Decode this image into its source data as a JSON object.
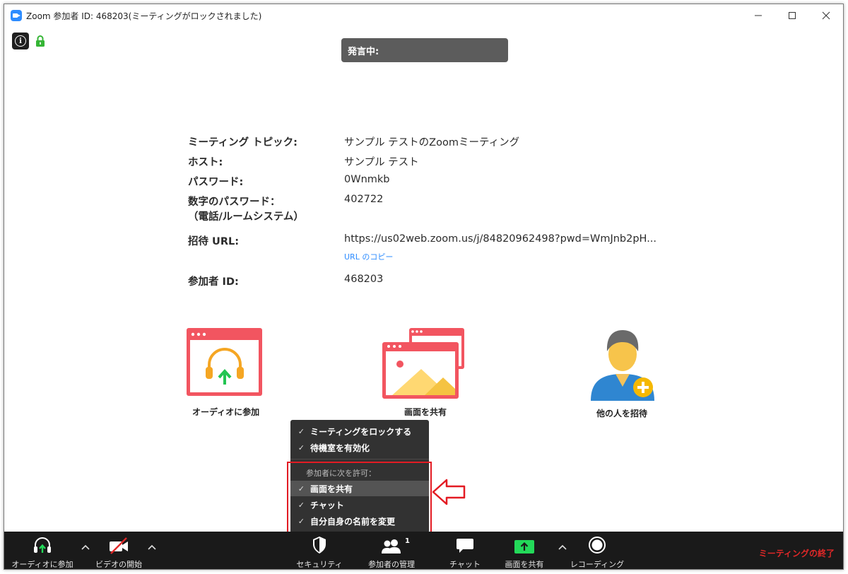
{
  "window": {
    "title": "Zoom 参加者 ID: 468203(ミーティングがロックされました)",
    "minimize": "—",
    "maximize": "☐",
    "close": "✕"
  },
  "speaking": "発言中:",
  "meeting_info": [
    {
      "label": "ミーティング トピック:",
      "value": "サンプル テストのZoomミーティング"
    },
    {
      "label": "ホスト:",
      "value": "サンプル テスト"
    },
    {
      "label": "パスワード:",
      "value": "0Wnmkb"
    },
    {
      "label": "数字のパスワード：",
      "label2": "（電話/ルームシステム）",
      "value": "402722"
    },
    {
      "label": "招待 URL:",
      "value": "https://us02web.zoom.us/j/84820962498?pwd=WmJnb2pH...",
      "link": "URL のコピー"
    },
    {
      "label": "参加者 ID:",
      "value": "468203"
    }
  ],
  "tiles": {
    "audio": "オーディオに参加",
    "share": "画面を共有",
    "invite": "他の人を招待"
  },
  "security_menu": {
    "items_top": [
      {
        "label": "ミーティングをロックする",
        "checked": true
      },
      {
        "label": "待機室を有効化",
        "checked": true
      }
    ],
    "section": "参加者に次を許可：",
    "items_allow": [
      {
        "label": "画面を共有",
        "checked": true,
        "highlighted": true
      },
      {
        "label": "チャット",
        "checked": true
      },
      {
        "label": "自分自身の名前を変更",
        "checked": true
      }
    ],
    "check_glyph": "✓"
  },
  "toolbar": {
    "audio": "オーディオに参加",
    "video": "ビデオの開始",
    "security": "セキュリティ",
    "participants": "参加者の管理",
    "participant_count": "1",
    "chat": "チャット",
    "share": "画面を共有",
    "record": "レコーディング",
    "end": "ミーティングの終了"
  },
  "colors": {
    "accent": "#2d8cff",
    "tile_red": "#f25560",
    "share_green": "#23d959",
    "end_red": "#e02828",
    "arrow_red": "#e31b23"
  }
}
